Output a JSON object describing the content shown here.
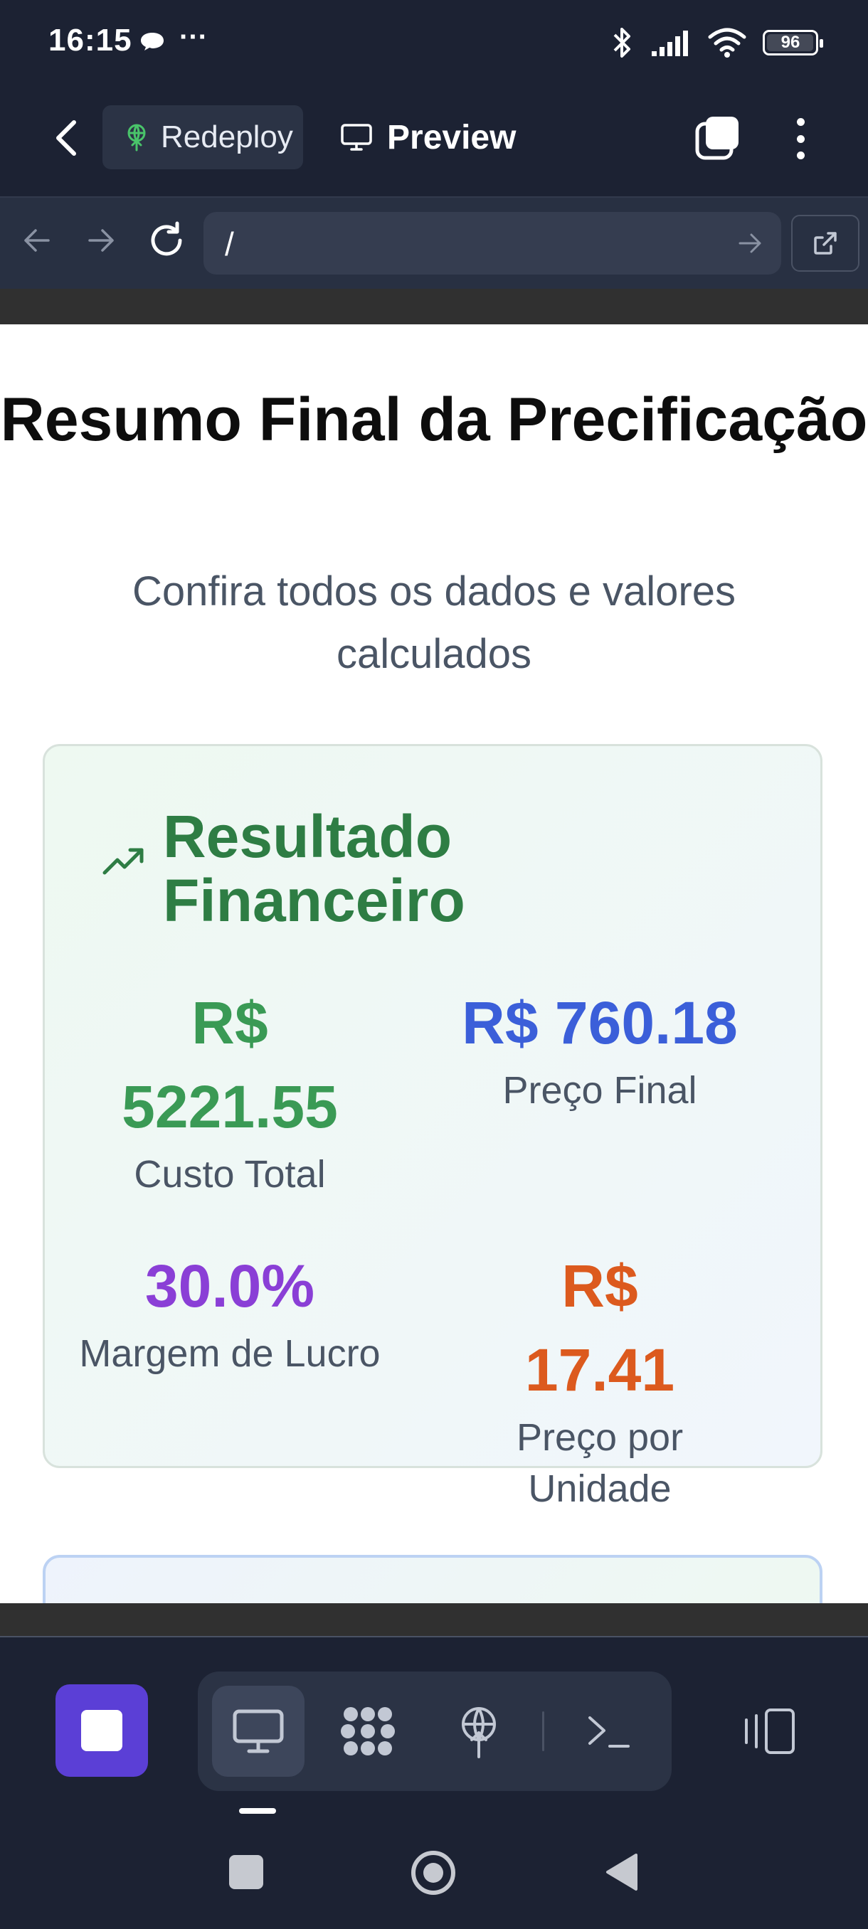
{
  "status_bar": {
    "time": "16:15",
    "more": "···",
    "battery": "96",
    "icons": [
      "chat-bubble-icon",
      "bluetooth-icon",
      "signal-icon",
      "wifi-icon",
      "battery-icon"
    ]
  },
  "app_bar": {
    "redeploy_label": "Redeploy",
    "preview_label": "Preview",
    "icons": [
      "back-arrow-icon",
      "deploy-icon",
      "monitor-icon",
      "tabs-icon",
      "more-vertical-icon"
    ]
  },
  "browser": {
    "url": "/",
    "icons": [
      "arrow-left-icon",
      "arrow-right-icon",
      "reload-icon",
      "go-arrow-icon",
      "external-link-icon"
    ]
  },
  "page": {
    "title": "Resumo Final da Precificação",
    "subtitle": "Confira todos os dados e valores calculados"
  },
  "result_card": {
    "title": "Resultado Financeiro",
    "metrics": [
      {
        "value": "R$ 5221.55",
        "label": "Custo Total",
        "color": "#3a9a55"
      },
      {
        "value": "R$ 760.18",
        "label": "Preço Final",
        "color": "#3b5fd9"
      },
      {
        "value": "30.0%",
        "label": "Margem de Lucro",
        "color": "#8a3fd6"
      },
      {
        "value": "R$ 17.41",
        "label": "Preço por Unidade",
        "color": "#dc5a1e"
      }
    ]
  },
  "dock": {
    "icons": [
      "stop-icon",
      "desktop-icon",
      "apps-grid-icon",
      "deploy-icon",
      "terminal-icon",
      "split-view-icon"
    ]
  },
  "colors": {
    "dark_bg": "#1c2233",
    "accent_purple": "#5b3fd6",
    "green_title": "#2e7d44"
  }
}
